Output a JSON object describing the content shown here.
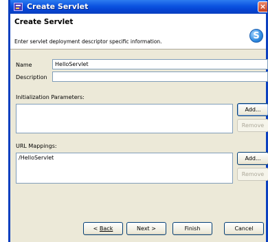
{
  "window": {
    "title": "Create Servlet"
  },
  "header": {
    "title": "Create Servlet",
    "description": "Enter servlet deployment descriptor specific information."
  },
  "form": {
    "name_label": "Name",
    "name_value": "HelloServlet",
    "description_label": "Description",
    "description_value": ""
  },
  "init_params": {
    "label": "Initialization Parameters:",
    "add_label": "Add...",
    "remove_label": "Remove",
    "items": []
  },
  "url_mappings": {
    "label": "URL Mappings:",
    "items": [
      "/HelloServlet"
    ],
    "add_label": "Add...",
    "remove_label": "Remove"
  },
  "footer": {
    "back_label": "Back",
    "next_label": "Next >",
    "finish_label": "Finish",
    "cancel_label": "Cancel"
  },
  "icons": {
    "app": "eclipse-dialog-icon",
    "close": "close-icon",
    "banner": "servlet-wizard-icon"
  }
}
